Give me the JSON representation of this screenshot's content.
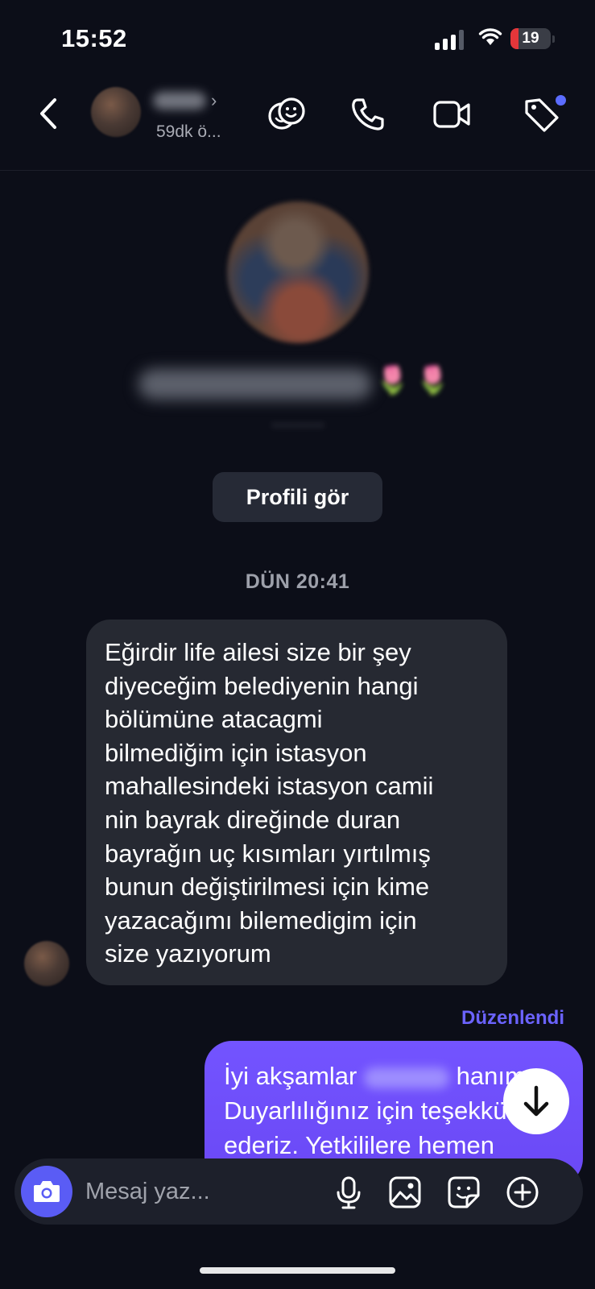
{
  "status_bar": {
    "time": "15:52",
    "battery": "19",
    "signal_bars": 3
  },
  "header": {
    "last_seen": "59dk ö...",
    "icons": [
      "back-icon",
      "chevron-right-icon",
      "emoji-faces-icon",
      "phone-icon",
      "video-camera-icon",
      "tag-icon"
    ]
  },
  "profile": {
    "view_profile_label": "Profili gör"
  },
  "conversation": {
    "timestamp": "DÜN 20:41",
    "incoming_message": "Eğirdir life ailesi size bir şey\ndiyeceğim belediyenin hangi\nbölümüne atacagmi\nbilmediğim için istasyon\nmahallesindeki istasyon camii\nnin bayrak direğinde duran\nbayrağın uç kısımları yırtılmış\nbunun değiştirilmesi için kime\nyazacağımı bilemedigim için\nsize yazıyorum",
    "edited_label": "Düzenlendi",
    "outgoing_message": {
      "line1_start": "İyi akşamlar",
      "line1_end": "hanım",
      "line2": "Duyarlılığınız için teşekkür",
      "line3": "ederiz. Yetkililere hemen"
    }
  },
  "composer": {
    "placeholder": "Mesaj yaz...",
    "icons": [
      "camera-icon",
      "microphone-icon",
      "gallery-icon",
      "sticker-icon",
      "plus-circle-icon"
    ]
  },
  "colors": {
    "accent": "#6a48f5",
    "background": "#0c0e18",
    "bubble_incoming": "#262932",
    "edited": "#6b63ff"
  }
}
